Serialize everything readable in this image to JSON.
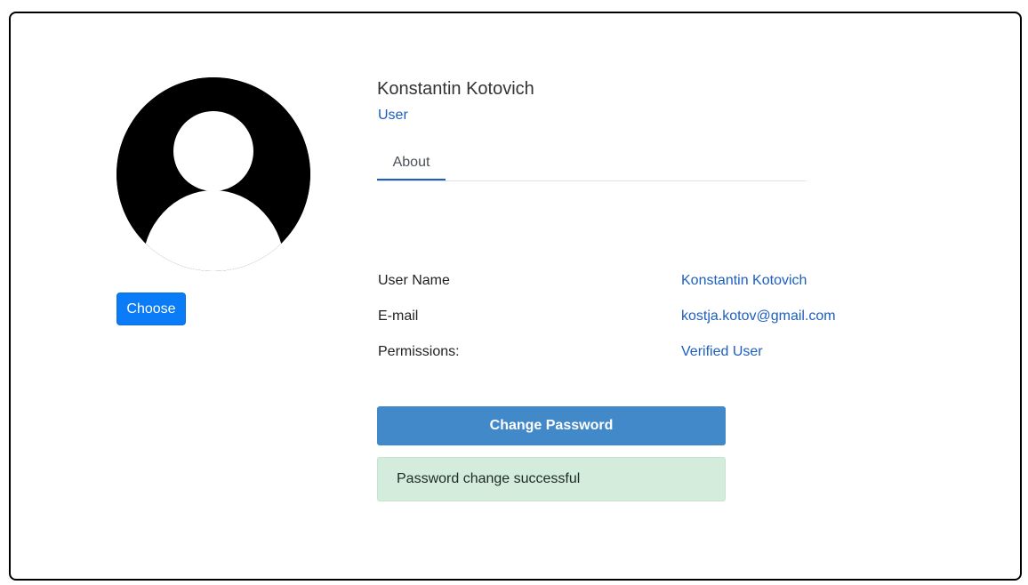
{
  "profile": {
    "name": "Konstantin Kotovich",
    "role": "User",
    "avatar_icon": "user-silhouette-icon",
    "choose_label": "Choose"
  },
  "tabs": [
    {
      "label": "About",
      "active": true
    }
  ],
  "about": [
    {
      "label": "User Name",
      "value": "Konstantin Kotovich"
    },
    {
      "label": "E-mail",
      "value": "kostja.kotov@gmail.com"
    },
    {
      "label": "Permissions:",
      "value": "Verified User"
    }
  ],
  "actions": {
    "change_password_label": "Change Password"
  },
  "alert": {
    "message": "Password change successful",
    "type": "success"
  },
  "colors": {
    "accent": "#1d5fbf",
    "primary_button": "#0a7cf7",
    "change_button": "#4289c9",
    "success_bg": "#d4ecdc"
  }
}
